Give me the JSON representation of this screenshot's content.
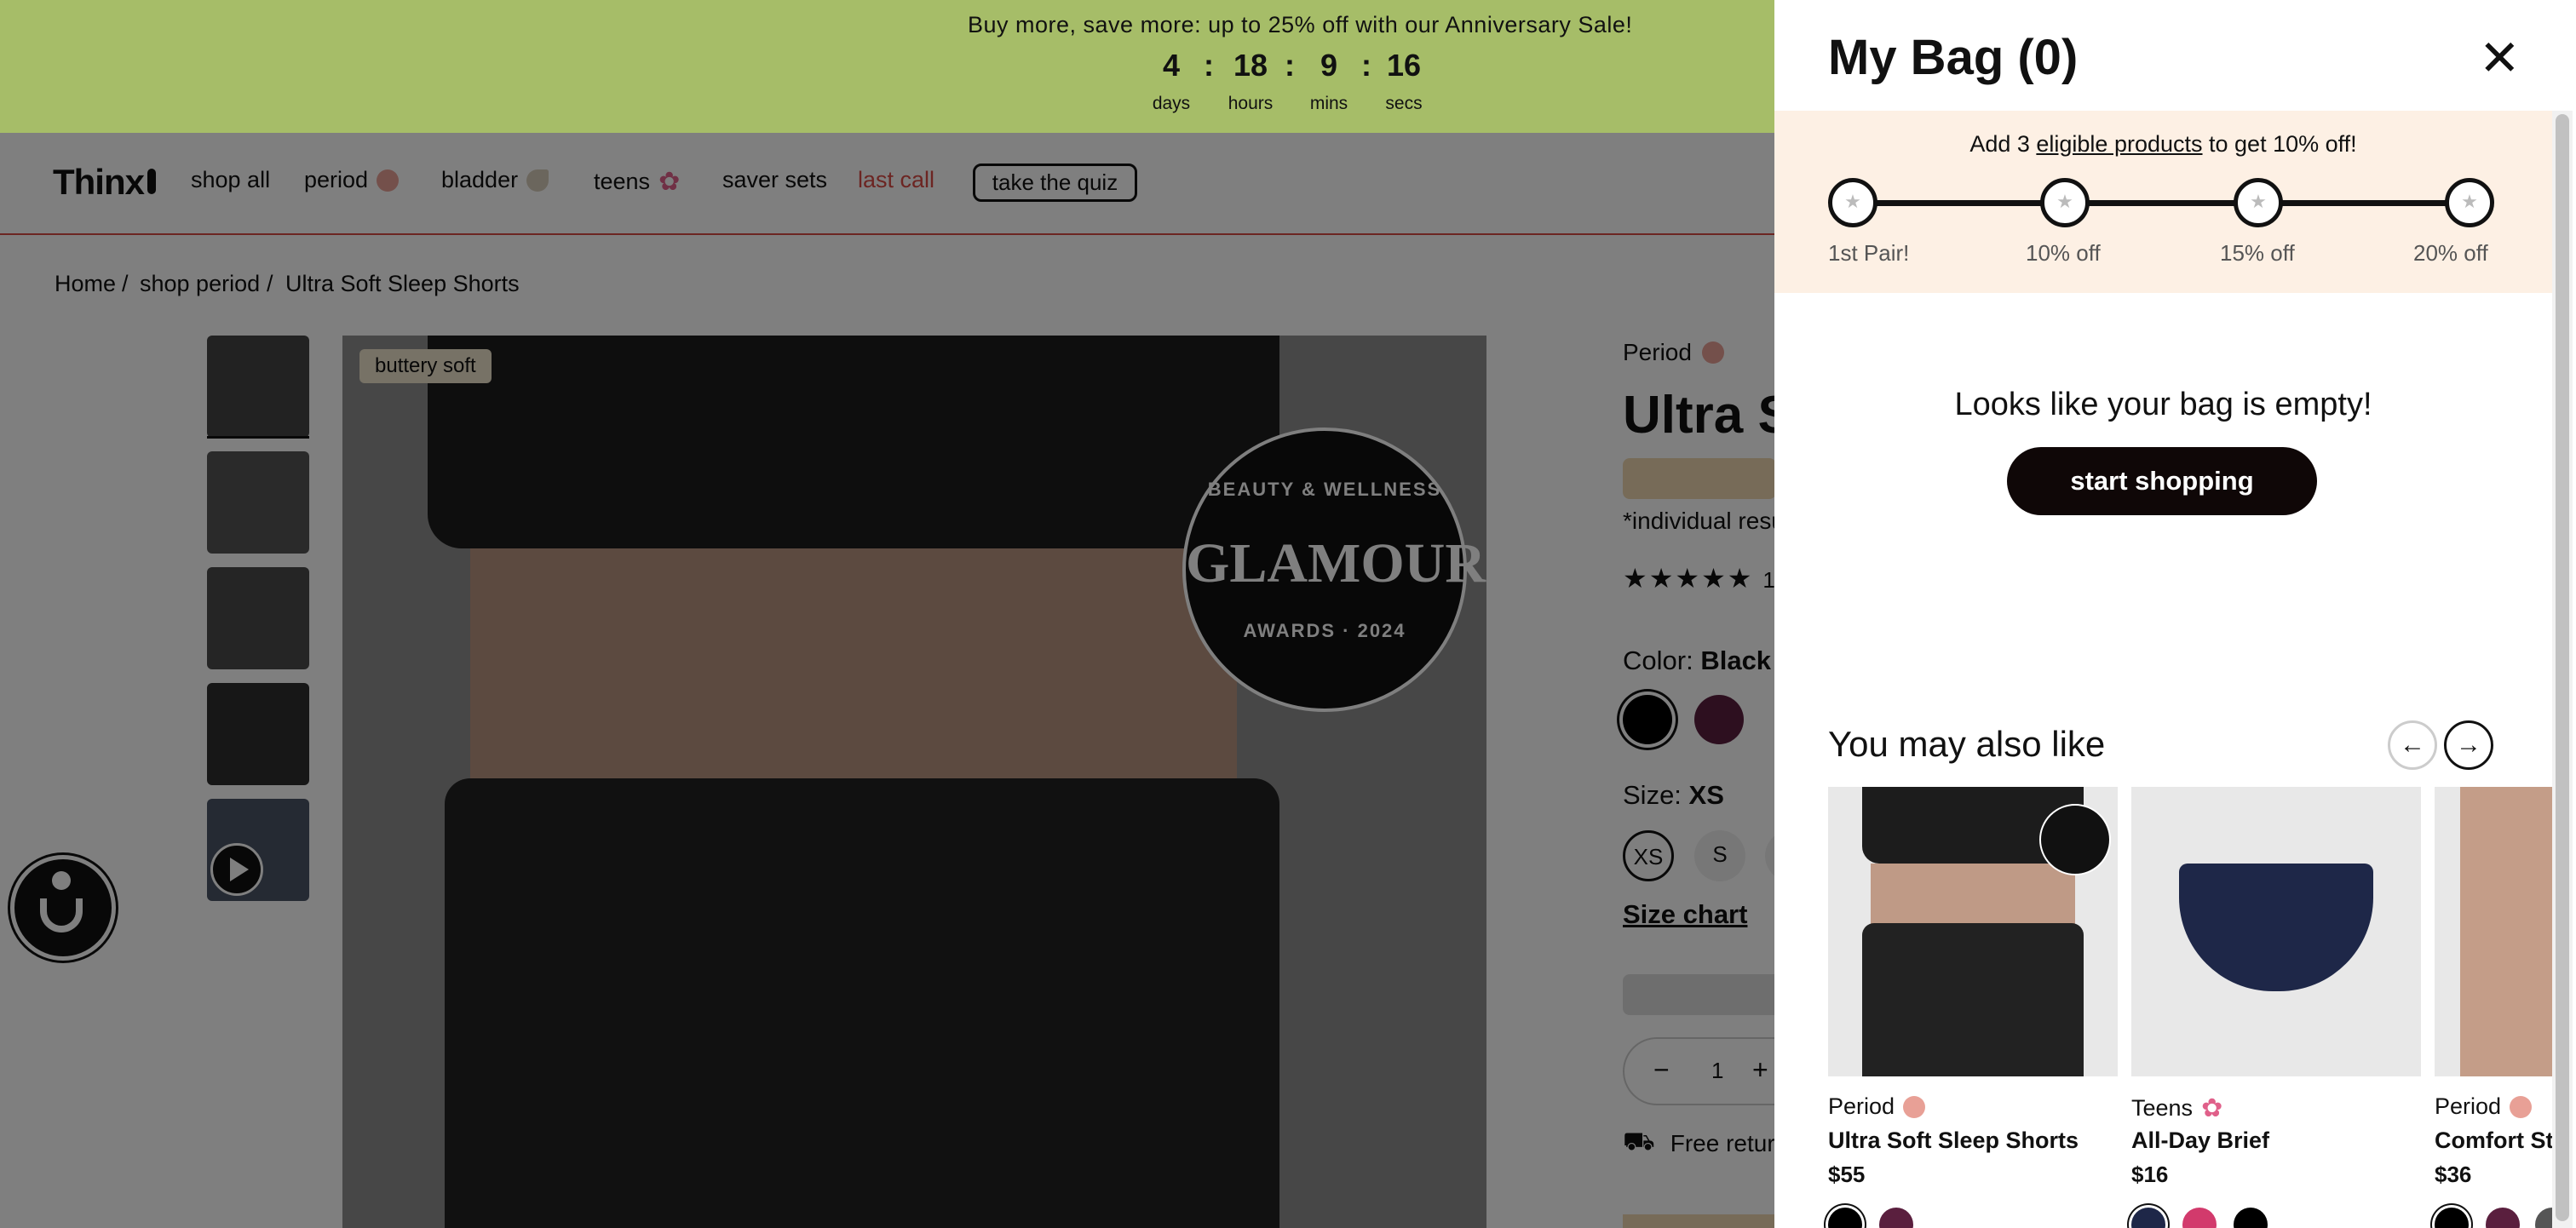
{
  "announcement": {
    "text": "Buy more, save more: up to 25% off with our  Anniversary Sale!",
    "countdown": [
      {
        "value": "4",
        "label": "days"
      },
      {
        "value": "18",
        "label": "hours"
      },
      {
        "value": "9",
        "label": "mins"
      },
      {
        "value": "16",
        "label": "secs"
      }
    ],
    "separator": ":",
    "bg_color": "#a6bd68"
  },
  "nav": {
    "logo": "Thinx",
    "items": [
      {
        "label": "shop all"
      },
      {
        "label": "period",
        "dot_color": "#e8a096"
      },
      {
        "label": "bladder",
        "dot_color": "#b7a98f"
      },
      {
        "label": "teens",
        "dot_color": "#e0608a"
      },
      {
        "label": "saver sets"
      },
      {
        "label": "last call",
        "color": "#d94a45"
      }
    ],
    "quiz": "take the quiz"
  },
  "breadcrumb": [
    "Home",
    "/",
    "shop period",
    "/",
    "Ultra Soft Sleep Shorts"
  ],
  "gallery": {
    "tag": "buttery soft",
    "badge": {
      "top": "BEAUTY & WELLNESS",
      "middle": "GLAMOUR",
      "bottom": "AWARDS · 2024"
    }
  },
  "product": {
    "category": "Period",
    "title": "Ultra So",
    "disclaimer": "*individual resu",
    "rating_count": "1",
    "color_label": "Color:",
    "color_value": "Black",
    "size_label": "Size:",
    "size_value": "XS",
    "sizes": [
      "XS",
      "S"
    ],
    "size_chart": "Size chart",
    "quantity": "1",
    "shipping": "Free return"
  },
  "drawer": {
    "title": "My Bag (0)",
    "promo": {
      "prefix": "Add 3 ",
      "link": "eligible products",
      "suffix": " to get 10% off!"
    },
    "steps": [
      "1st Pair!",
      "10% off",
      "15% off",
      "20% off"
    ],
    "empty": "Looks like your bag is empty!",
    "cta": "start shopping",
    "recs_title": "You may also like",
    "recs": [
      {
        "category": "Period",
        "name": "Ultra Soft Sleep Shorts",
        "price": "$55",
        "dot_color": "#e8a096"
      },
      {
        "category": "Teens",
        "name": "All-Day Brief",
        "price": "$16",
        "dot_color": "#e0608a"
      },
      {
        "category": "Period",
        "name": "Comfort St",
        "price": "$36",
        "dot_color": "#e8a096"
      }
    ]
  }
}
